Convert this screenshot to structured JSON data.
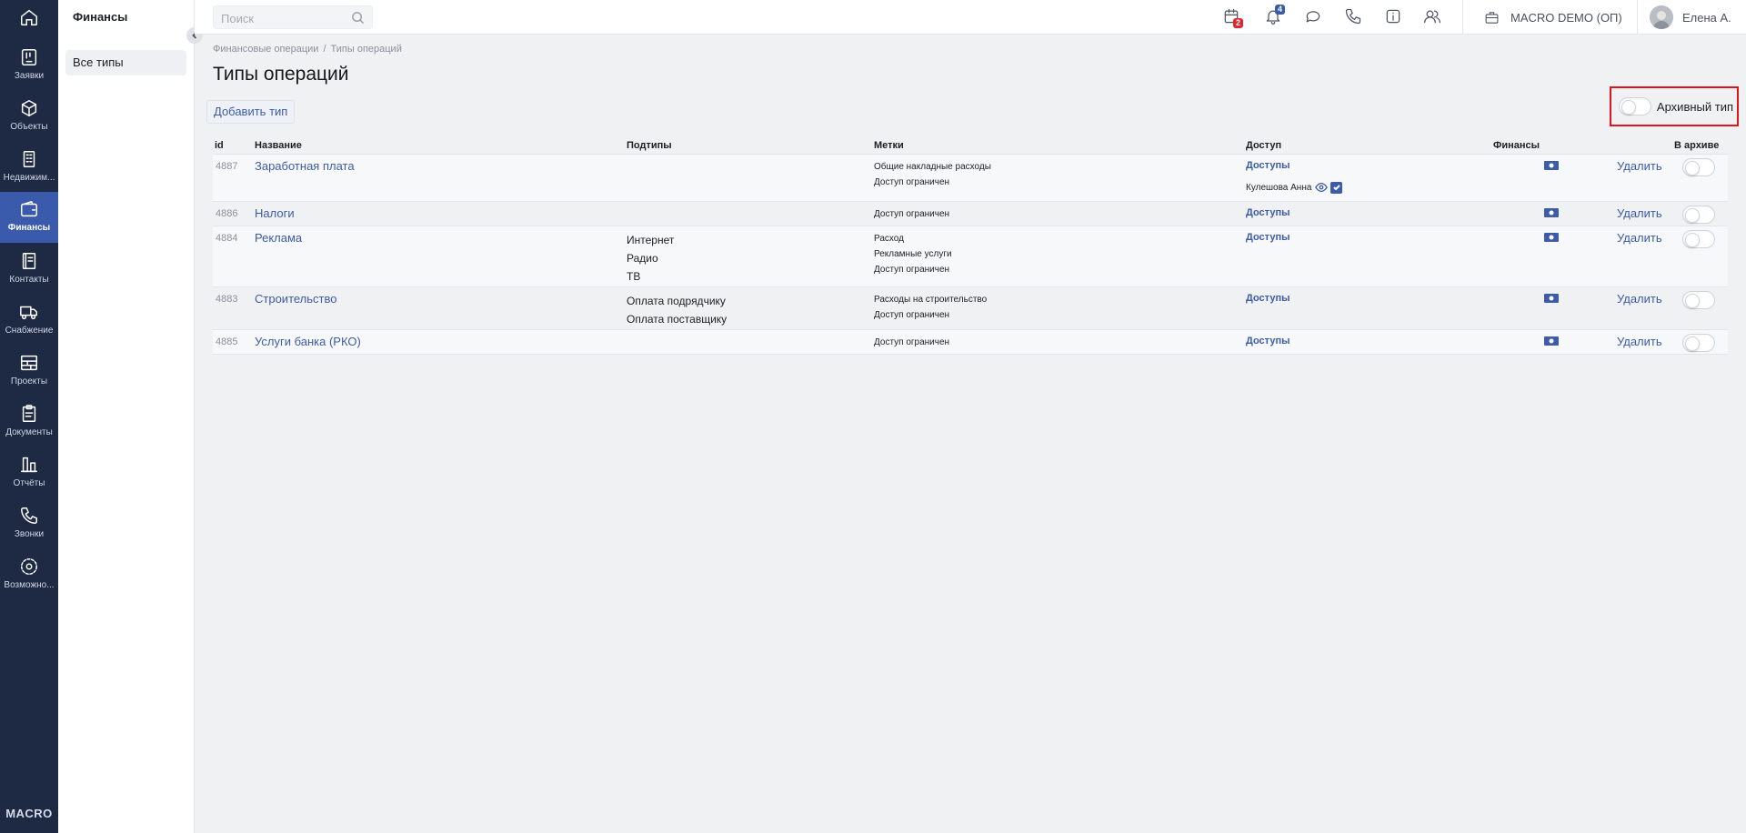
{
  "rail": {
    "items": [
      {
        "label": "Заявки",
        "icon": "requests-icon"
      },
      {
        "label": "Объекты",
        "icon": "cube-icon"
      },
      {
        "label": "Недвижим...",
        "icon": "building-icon"
      },
      {
        "label": "Финансы",
        "icon": "wallet-icon",
        "active": true
      },
      {
        "label": "Контакты",
        "icon": "contacts-icon"
      },
      {
        "label": "Снабжение",
        "icon": "truck-icon"
      },
      {
        "label": "Проекты",
        "icon": "projects-icon"
      },
      {
        "label": "Документы",
        "icon": "clipboard-icon"
      },
      {
        "label": "Отчёты",
        "icon": "reports-icon"
      },
      {
        "label": "Звонки",
        "icon": "phone-icon"
      },
      {
        "label": "Возможно...",
        "icon": "gear-icon"
      }
    ],
    "logo": "MACRO"
  },
  "section": {
    "title": "Финансы",
    "item": "Все типы"
  },
  "topbar": {
    "search_placeholder": "Поиск",
    "calendar_badge": "2",
    "notifications_badge": "4",
    "org": "MACRO DEMO (ОП)",
    "user": "Елена А."
  },
  "breadcrumb": {
    "parent": "Финансовые операции",
    "current": "Типы операций"
  },
  "page": {
    "title": "Типы операций",
    "add_button": "Добавить тип",
    "archive_toggle_label": "Архивный тип"
  },
  "table": {
    "headers": {
      "id": "id",
      "name": "Название",
      "subtypes": "Подтипы",
      "tags": "Метки",
      "access": "Доступ",
      "finance": "Финансы",
      "archived": "В архиве"
    },
    "delete_label": "Удалить",
    "access_label": "Доступы",
    "rows": [
      {
        "id": "4887",
        "name": "Заработная плата",
        "subtypes": [],
        "tags": [
          "Общие накладные расходы",
          "Доступ ограничен"
        ],
        "access_user": "Кулешова Анна"
      },
      {
        "id": "4886",
        "name": "Налоги",
        "subtypes": [],
        "tags": [
          "Доступ ограничен"
        ],
        "access_user": ""
      },
      {
        "id": "4884",
        "name": "Реклама",
        "subtypes": [
          "Интернет",
          "Радио",
          "ТВ"
        ],
        "tags": [
          "Расход",
          "Рекламные услуги",
          "Доступ ограничен"
        ],
        "access_user": ""
      },
      {
        "id": "4883",
        "name": "Строительство",
        "subtypes": [
          "Оплата подрядчику",
          "Оплата поставщику"
        ],
        "tags": [
          "Расходы на строительство",
          "Доступ ограничен"
        ],
        "access_user": ""
      },
      {
        "id": "4885",
        "name": "Услуги банка (РКО)",
        "subtypes": [],
        "tags": [
          "Доступ ограничен"
        ],
        "access_user": ""
      }
    ]
  },
  "colors": {
    "rail_bg": "#1e2944",
    "rail_active": "#3a5bab",
    "link": "#3d5ba9",
    "highlight_border": "#e0141e",
    "calendar_badge": "#e0262f",
    "notification_badge": "#3a5bab"
  }
}
